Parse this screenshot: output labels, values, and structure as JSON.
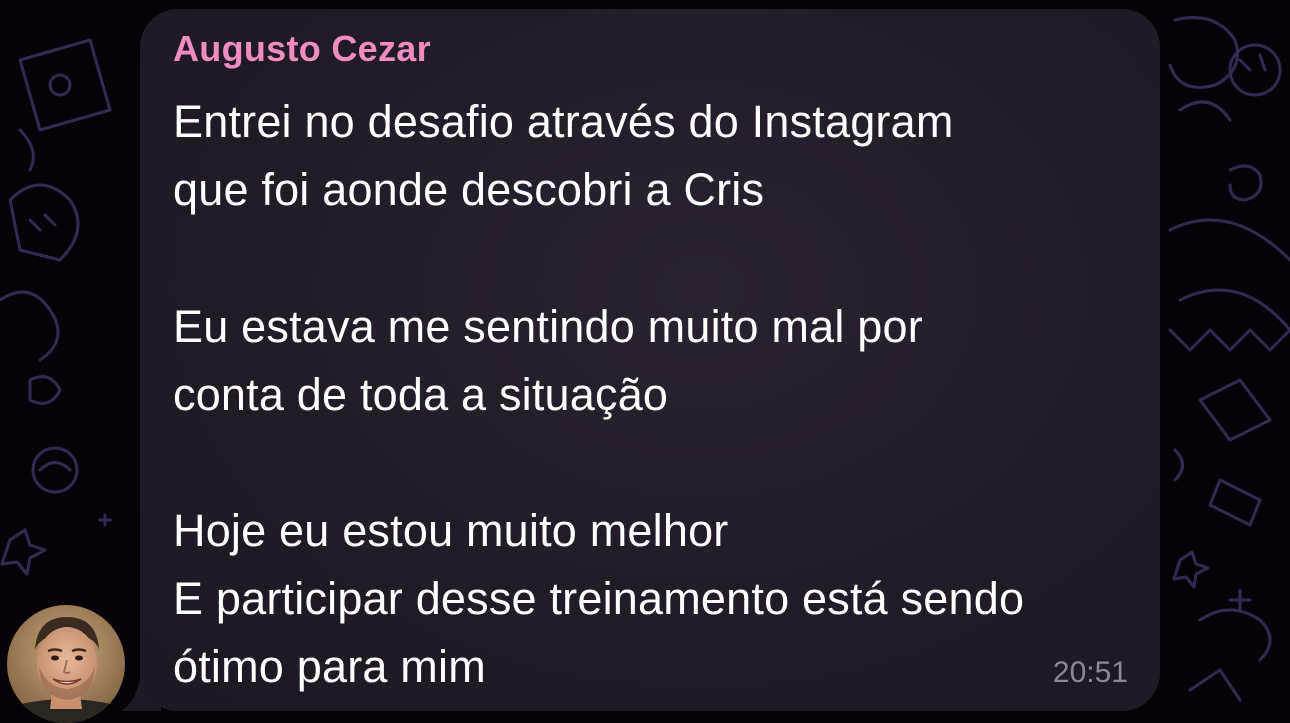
{
  "message": {
    "sender": "Augusto Cezar",
    "lines": [
      "Entrei no desafio através do Instagram",
      "que foi aonde descobri a Cris",
      "Eu estava me sentindo muito mal por",
      "conta de toda a situação",
      "Hoje eu estou muito melhor",
      "E participar desse treinamento está sendo",
      "ótimo para mim"
    ],
    "time": "20:51"
  },
  "colors": {
    "bubble": "#231c29",
    "sender_name": "#f08cc0",
    "text": "#ffffff",
    "timestamp": "#8e8795",
    "background": "#050308",
    "doodle": "#3a2f5a"
  }
}
